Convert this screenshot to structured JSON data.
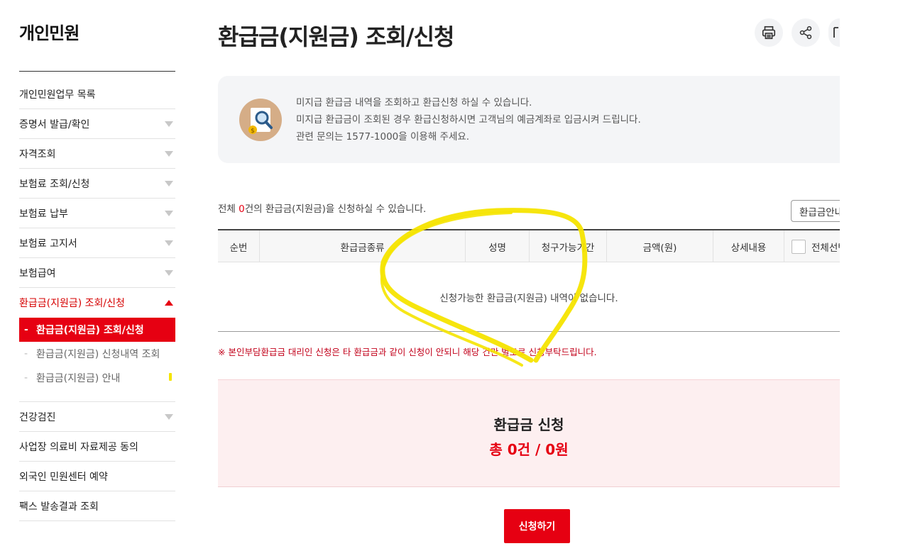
{
  "sidebar": {
    "title": "개인민원",
    "items": [
      {
        "label": "개인민원업무 목록"
      },
      {
        "label": "증명서 발급/확인"
      },
      {
        "label": "자격조회"
      },
      {
        "label": "보험료 조회/신청"
      },
      {
        "label": "보험료 납부"
      },
      {
        "label": "보험료 고지서"
      },
      {
        "label": "보험급여"
      },
      {
        "label": "환급금(지원금) 조회/신청"
      },
      {
        "label": "건강검진"
      },
      {
        "label": "사업장 의료비 자료제공 동의"
      },
      {
        "label": "외국인 민원센터 예약"
      },
      {
        "label": "팩스 발송결과 조회"
      }
    ],
    "submenu": [
      {
        "label": "환급금(지원금) 조회/신청"
      },
      {
        "label": "환급금(지원금) 신청내역 조회"
      },
      {
        "label": "환급금(지원금) 안내"
      }
    ]
  },
  "header": {
    "title": "환급금(지원금) 조회/신청",
    "toolbar": [
      "print-icon",
      "share-icon",
      "bookmark-icon"
    ]
  },
  "info": {
    "icon": "document-search-icon",
    "lines": [
      "미지급 환급금 내역을 조회하고 환급신청 하실 수 있습니다.",
      "미지급 환급금이 조회된 경우 환급신청하시면 고객님의 예금계좌로 입금시켜 드립니다.",
      "관련 문의는 1577-1000을 이용해 주세요."
    ]
  },
  "list": {
    "count_prefix": "전체 ",
    "count": "0",
    "count_suffix": "건의 환급금(지원금)을 신청하실 수 있습니다.",
    "guide_button": "환급금안내"
  },
  "table": {
    "columns": [
      "순번",
      "환급금종류",
      "성명",
      "청구가능기간",
      "금액(원)",
      "상세내용",
      "전체선택"
    ],
    "empty_message": "신청가능한 환급금(지원금) 내역이 없습니다."
  },
  "notice": "※ 본인부담환급금 대리인 신청은 타 환급금과 같이 신청이 안되니 해당 건만 별도로 신청부탁드립니다.",
  "summary": {
    "title": "환급금 신청",
    "total": "총 0건 / 0원"
  },
  "apply_button": "신청하기",
  "colors": {
    "accent": "#e60012",
    "highlight": "#f5e400"
  }
}
